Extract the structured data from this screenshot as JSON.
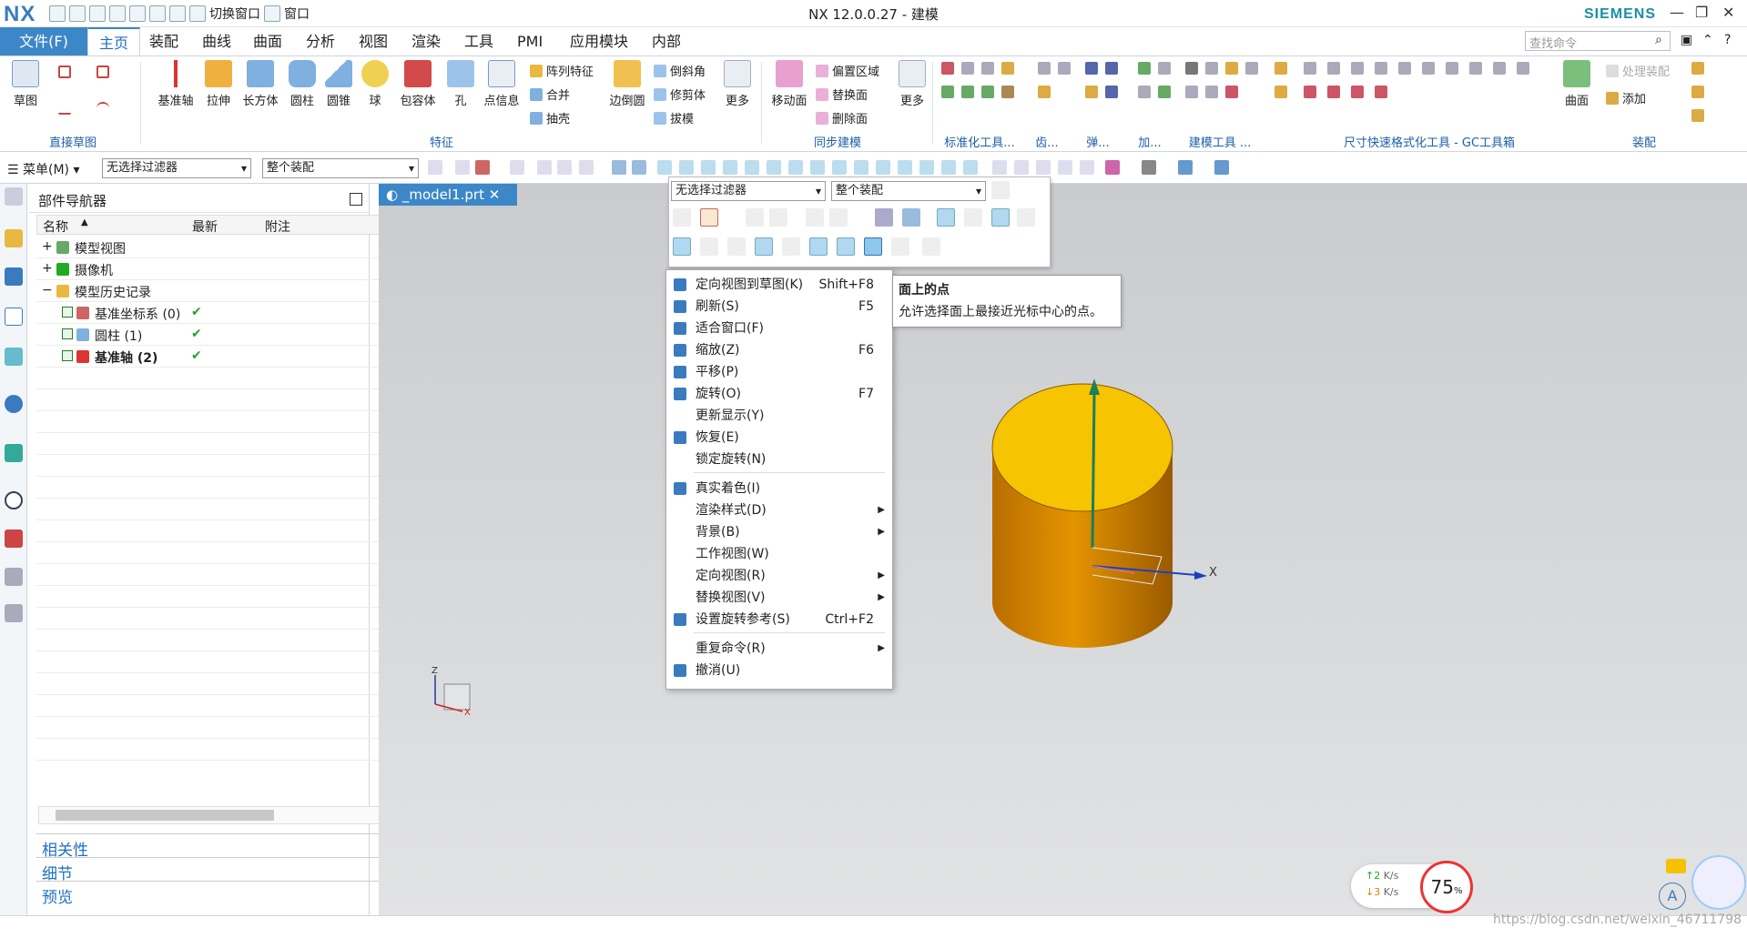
{
  "app": {
    "logo": "NX",
    "title": "NX 12.0.0.27 - 建模",
    "brand": "SIEMENS",
    "quick": {
      "switch_window": "切换窗口",
      "window": "窗口"
    }
  },
  "tabs": {
    "file": "文件(F)",
    "items": [
      "主页",
      "装配",
      "曲线",
      "曲面",
      "分析",
      "视图",
      "渲染",
      "工具",
      "PMI",
      "应用模块",
      "内部"
    ],
    "active": "主页"
  },
  "search": {
    "placeholder": "查找命令"
  },
  "ribbon": {
    "sketch": "草图",
    "direct_sketch": "直接草图",
    "feature_btns": [
      "基准轴",
      "拉伸",
      "长方体",
      "圆柱",
      "圆锥",
      "球",
      "包容体",
      "孔",
      "点信息"
    ],
    "feature_small": [
      "阵列特征",
      "合并",
      "抽壳",
      "倒斜角",
      "修剪体",
      "拔模"
    ],
    "edge_blend": "边倒圆",
    "more1": "更多",
    "feature_group": "特征",
    "move_face": "移动面",
    "sync_small": [
      "偏置区域",
      "替换面",
      "删除面"
    ],
    "more2": "更多",
    "sync_group": "同步建模",
    "groups2": [
      "标准化工具...",
      "齿...",
      "弹...",
      "加...",
      "建模工具 ...",
      "尺寸快速格式化工具 - GC工具箱",
      "装配"
    ],
    "surface": "曲面",
    "process_assembly": "处理装配",
    "add": "添加"
  },
  "filterbar": {
    "menu": "菜单(M)",
    "filter": "无选择过滤器",
    "scope": "整个装配"
  },
  "navigator": {
    "title": "部件导航器",
    "cols": [
      "名称",
      "最新",
      "附注"
    ],
    "rows": [
      {
        "label": "模型视图",
        "indent": 0,
        "latest": ""
      },
      {
        "label": "摄像机",
        "indent": 0,
        "latest": ""
      },
      {
        "label": "模型历史记录",
        "indent": 0,
        "latest": ""
      },
      {
        "label": "基准坐标系 (0)",
        "indent": 1,
        "latest": "✔"
      },
      {
        "label": "圆柱 (1)",
        "indent": 1,
        "latest": "✔"
      },
      {
        "label": "基准轴 (2)",
        "indent": 1,
        "latest": "✔"
      }
    ],
    "panels": [
      "相关性",
      "细节",
      "预览"
    ]
  },
  "doc_tab": "_model1.prt",
  "minitoolbar": {
    "filter": "无选择过滤器",
    "scope": "整个装配"
  },
  "context_menu": [
    {
      "label": "定向视图到草图(K)",
      "shortcut": "Shift+F8",
      "icon": "sketch-view-icon"
    },
    {
      "label": "刷新(S)",
      "shortcut": "F5",
      "icon": "refresh-icon"
    },
    {
      "label": "适合窗口(F)",
      "shortcut": "",
      "icon": "fit-icon"
    },
    {
      "label": "缩放(Z)",
      "shortcut": "F6",
      "icon": "zoom-icon"
    },
    {
      "label": "平移(P)",
      "shortcut": "",
      "icon": "pan-icon"
    },
    {
      "label": "旋转(O)",
      "shortcut": "F7",
      "icon": "rotate-icon"
    },
    {
      "label": "更新显示(Y)",
      "shortcut": "",
      "icon": ""
    },
    {
      "label": "恢复(E)",
      "shortcut": "",
      "icon": "restore-icon"
    },
    {
      "label": "锁定旋转(N)",
      "shortcut": "",
      "icon": ""
    },
    {
      "label": "真实着色(I)",
      "shortcut": "",
      "icon": "true-shading-icon",
      "sep": true
    },
    {
      "label": "渲染样式(D)",
      "shortcut": "",
      "icon": "",
      "sub": true
    },
    {
      "label": "背景(B)",
      "shortcut": "",
      "icon": "",
      "sub": true
    },
    {
      "label": "工作视图(W)",
      "shortcut": "",
      "icon": ""
    },
    {
      "label": "定向视图(R)",
      "shortcut": "",
      "icon": "",
      "sub": true
    },
    {
      "label": "替换视图(V)",
      "shortcut": "",
      "icon": "",
      "sub": true
    },
    {
      "label": "设置旋转参考(S)",
      "shortcut": "Ctrl+F2",
      "icon": "rotate-ref-icon"
    },
    {
      "label": "重复命令(R)",
      "shortcut": "",
      "icon": "",
      "sub": true,
      "sep": true
    },
    {
      "label": "撤消(U)",
      "shortcut": "",
      "icon": "undo-icon"
    }
  ],
  "tooltip": {
    "title": "面上的点",
    "desc": "允许选择面上最接近光标中心的点。"
  },
  "axes": {
    "x": "X",
    "z": "Z"
  },
  "netspeed": {
    "up": "2",
    "down": "3",
    "unit": "K/s",
    "percent": "75",
    "percent_unit": "%"
  },
  "watermark": "https://blog.csdn.net/weixin_46711798",
  "colors": {
    "accent": "#3c87c7",
    "cyl_top": "#f5c200",
    "cyl_side": "#d68a00"
  }
}
